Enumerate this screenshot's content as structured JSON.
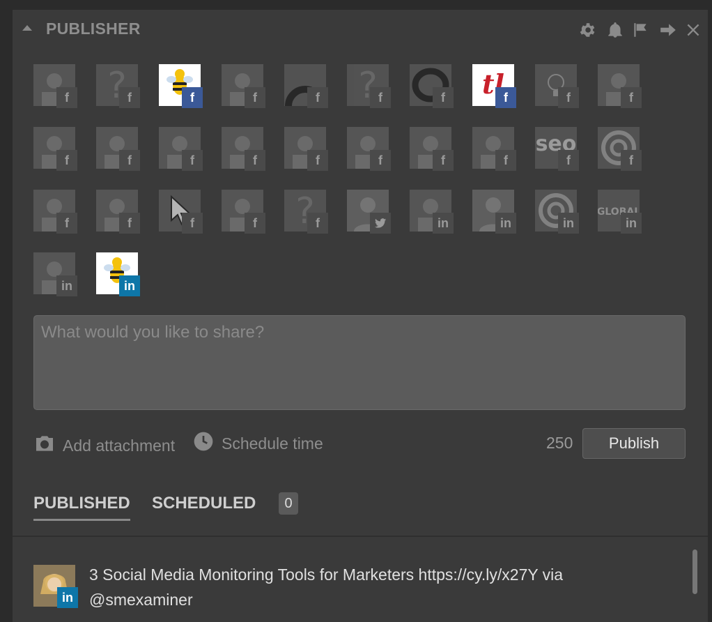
{
  "header": {
    "title": "PUBLISHER"
  },
  "accounts": [
    {
      "id": "acct-1",
      "network": "facebook",
      "net_glyph": "f",
      "avatar": "person",
      "active": false
    },
    {
      "id": "acct-2",
      "network": "facebook",
      "net_glyph": "f",
      "avatar": "question",
      "active": false
    },
    {
      "id": "acct-3",
      "network": "facebook",
      "net_glyph": "f",
      "avatar": "bee",
      "active": true
    },
    {
      "id": "acct-4",
      "network": "facebook",
      "net_glyph": "f",
      "avatar": "group",
      "active": false
    },
    {
      "id": "acct-5",
      "network": "facebook",
      "net_glyph": "f",
      "avatar": "arc",
      "active": false
    },
    {
      "id": "acct-6",
      "network": "facebook",
      "net_glyph": "f",
      "avatar": "question",
      "active": false
    },
    {
      "id": "acct-7",
      "network": "facebook",
      "net_glyph": "f",
      "avatar": "ring",
      "active": false
    },
    {
      "id": "acct-8",
      "network": "facebook",
      "net_glyph": "f",
      "avatar": "tl-logo",
      "active": true
    },
    {
      "id": "acct-9",
      "network": "facebook",
      "net_glyph": "f",
      "avatar": "bulb",
      "active": false
    },
    {
      "id": "acct-10",
      "network": "facebook",
      "net_glyph": "f",
      "avatar": "wink",
      "active": false
    },
    {
      "id": "acct-11",
      "network": "facebook",
      "net_glyph": "f",
      "avatar": "arrow",
      "active": false
    },
    {
      "id": "acct-12",
      "network": "facebook",
      "net_glyph": "f",
      "avatar": "dofollow",
      "active": false
    },
    {
      "id": "acct-13",
      "network": "facebook",
      "net_glyph": "f",
      "avatar": "bee-outline",
      "active": false
    },
    {
      "id": "acct-14",
      "network": "facebook",
      "net_glyph": "f",
      "avatar": "buy-sell",
      "active": false
    },
    {
      "id": "acct-15",
      "network": "facebook",
      "net_glyph": "f",
      "avatar": "photo",
      "active": false
    },
    {
      "id": "acct-16",
      "network": "facebook",
      "net_glyph": "f",
      "avatar": "sun",
      "active": false
    },
    {
      "id": "acct-17",
      "network": "facebook",
      "net_glyph": "f",
      "avatar": "book",
      "active": false
    },
    {
      "id": "acct-18",
      "network": "facebook",
      "net_glyph": "f",
      "avatar": "blog",
      "active": false
    },
    {
      "id": "acct-19",
      "network": "facebook",
      "net_glyph": "f",
      "avatar": "seo",
      "active": false
    },
    {
      "id": "acct-20",
      "network": "facebook",
      "net_glyph": "f",
      "avatar": "spiral",
      "active": false
    },
    {
      "id": "acct-21",
      "network": "facebook",
      "net_glyph": "f",
      "avatar": "face",
      "active": false
    },
    {
      "id": "acct-22",
      "network": "facebook",
      "net_glyph": "f",
      "avatar": "speech",
      "active": false
    },
    {
      "id": "acct-23",
      "network": "facebook",
      "net_glyph": "f",
      "avatar": "cursor",
      "active": false
    },
    {
      "id": "acct-24",
      "network": "facebook",
      "net_glyph": "f",
      "avatar": "guest-blogger",
      "active": false
    },
    {
      "id": "acct-25",
      "network": "facebook",
      "net_glyph": "f",
      "avatar": "question",
      "active": false
    },
    {
      "id": "acct-26",
      "network": "twitter",
      "net_glyph": "🐦",
      "avatar": "silhouette",
      "active": false
    },
    {
      "id": "acct-27",
      "network": "linkedin",
      "net_glyph": "in",
      "avatar": "woman",
      "active": false
    },
    {
      "id": "acct-28",
      "network": "linkedin",
      "net_glyph": "in",
      "avatar": "silhouette",
      "active": false
    },
    {
      "id": "acct-29",
      "network": "linkedin",
      "net_glyph": "in",
      "avatar": "spiral",
      "active": false
    },
    {
      "id": "acct-30",
      "network": "linkedin",
      "net_glyph": "in",
      "avatar": "global",
      "active": false
    },
    {
      "id": "acct-31",
      "network": "linkedin",
      "net_glyph": "in",
      "avatar": "blog",
      "active": false
    },
    {
      "id": "acct-32",
      "network": "linkedin",
      "net_glyph": "in",
      "avatar": "bee",
      "active": true
    }
  ],
  "composer": {
    "placeholder": "What would you like to share?",
    "value": ""
  },
  "toolbar": {
    "add_attachment_label": "Add attachment",
    "schedule_label": "Schedule time",
    "char_count": "250",
    "publish_label": "Publish"
  },
  "tabs": {
    "published_label": "PUBLISHED",
    "scheduled_label": "SCHEDULED",
    "scheduled_count": "0"
  },
  "feed": [
    {
      "network": "linkedin",
      "net_glyph": "in",
      "text": "3 Social Media Monitoring Tools for Marketers https://cy.ly/x27Y via @smexaminer"
    }
  ],
  "colors": {
    "panel_bg": "#3a3a3a",
    "facebook": "#3b5998",
    "linkedin": "#0e76a8",
    "muted_text": "#8e8e8e"
  }
}
